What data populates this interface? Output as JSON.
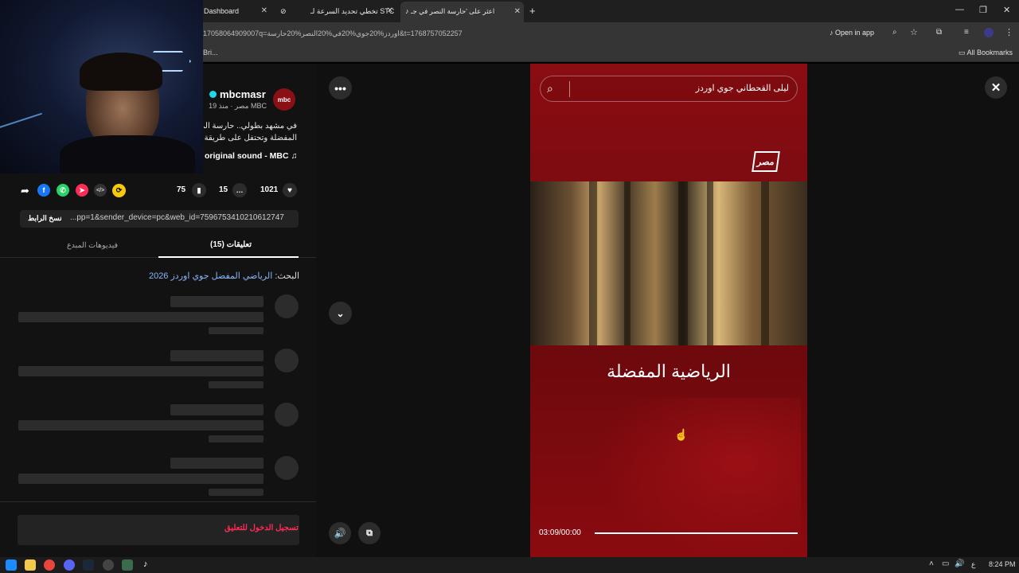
{
  "browser": {
    "tabs": [
      {
        "label": "Dashboard"
      },
      {
        "label": ""
      },
      {
        "label": "تخطي تحديد السرعة لـ STC"
      },
      {
        "label": "اعثر على 'حارسة النصر في جـ"
      }
    ],
    "url": "517058064909007q=اوردز%20جوي%20في%20النصر%20حارسة&t=1768757052257",
    "open_in_app": "Open in app",
    "bookmark_partial": "Bri...",
    "all_bookmarks": "All Bookmarks"
  },
  "post": {
    "username": "mbcmasr",
    "meta_line": "MBC مصر · منذ 19",
    "caption_line1": "في مشهد بطولي.. حارسة المرمى",
    "caption_line2": "المفضلة وتحتفل على طريقة كر",
    "sound": "original sound - MBC",
    "likes": "1021",
    "comments": "15",
    "saves": "75",
    "copy_link_label": "نسخ الرابط",
    "link_value": "...pp=1&sender_device=pc&web_id=7596753410210612747",
    "tab_comments": "(15) تعليقات",
    "tab_creator_videos": "فيديوهات المبدع",
    "search_prefix": "البحث:",
    "search_link": "الرياضي المفضل جوي اوردز 2026",
    "login_to_comment": "تسجيل الدخول للتعليق"
  },
  "video": {
    "search_text": "ليلى القحطاني جوي اوردز",
    "logo_text": "مصر",
    "headline": "الرياضية المفضلة",
    "time": "03:09/00:00",
    "progress": 1.0
  },
  "taskbar": {
    "clock": "8:24 PM",
    "lang": "ع"
  },
  "colors": {
    "video_red": "#8a0d12",
    "accent_pink": "#fe2c55",
    "link_blue": "#8ab4f8"
  }
}
